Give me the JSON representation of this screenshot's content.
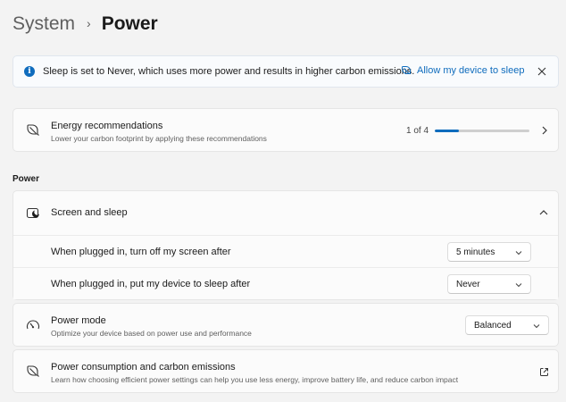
{
  "breadcrumb": {
    "parent": "System",
    "separator": "›",
    "current": "Power"
  },
  "infobar": {
    "icon": "info-icon",
    "message": "Sleep is set to Never, which uses more power and results in higher carbon emissions.",
    "action_label": "Allow my device to sleep",
    "action_icon": "leaf-icon",
    "close_icon": "close-icon"
  },
  "energy_recommendations": {
    "icon": "leaf-icon",
    "title": "Energy recommendations",
    "description": "Lower your carbon footprint by applying these recommendations",
    "progress_label": "1 of 4",
    "progress_fraction": 0.25
  },
  "section_power": {
    "label": "Power"
  },
  "screen_and_sleep": {
    "icon": "screen-sleep-icon",
    "title": "Screen and sleep",
    "expanded": true,
    "settings": [
      {
        "label": "When plugged in, turn off my screen after",
        "value": "5 minutes"
      },
      {
        "label": "When plugged in, put my device to sleep after",
        "value": "Never"
      }
    ]
  },
  "power_mode": {
    "icon": "speedometer-icon",
    "title": "Power mode",
    "description": "Optimize your device based on power use and performance",
    "value": "Balanced"
  },
  "power_consumption": {
    "icon": "leaf-icon",
    "title": "Power consumption and carbon emissions",
    "description": "Learn how choosing efficient power settings can help you use less energy, improve battery life, and reduce carbon impact",
    "link_icon": "open-external-icon"
  },
  "colors": {
    "accent": "#0f6cbd",
    "background": "#f3f3f3",
    "card": "#fbfbfb"
  }
}
